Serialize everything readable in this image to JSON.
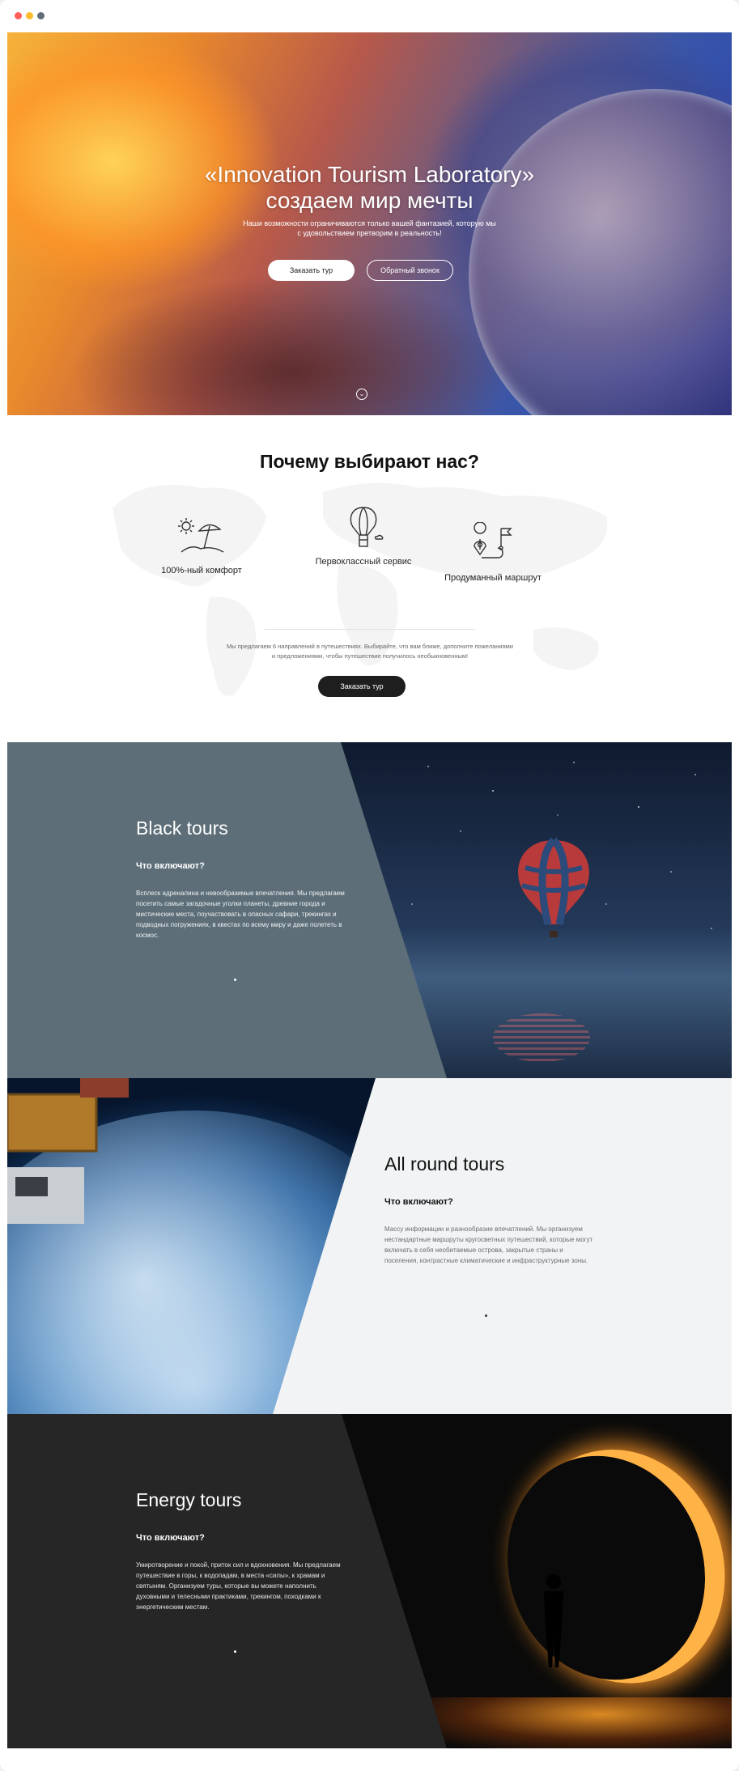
{
  "hero": {
    "title_line1": "«Innovation Tourism Laboratory»",
    "title_line2": "создаем мир мечты",
    "subtitle": "Наши возможности ограничиваются только вашей фантазией, которую мы с удовольствием претворим в реальность!",
    "order_button": "Заказать тур",
    "callback_button": "Обратный звонок",
    "scroll_icon": "chevron-down-icon"
  },
  "why": {
    "title": "Почему выбирают нас?",
    "features": [
      {
        "label": "100%-ный комфорт",
        "icon": "beach-umbrella-icon"
      },
      {
        "label": "Первоклассный сервис",
        "icon": "hot-air-balloon-icon"
      },
      {
        "label": "Продуманный маршрут",
        "icon": "route-map-icon"
      }
    ],
    "description": "Мы предлагаем 6 направлений в путешествиях. Выбирайте, что вам ближе, дополните пожеланиями и предложениями, чтобы путешествие получилось необыкновенным!",
    "button": "Заказать тур"
  },
  "tours": [
    {
      "title": "Black tours",
      "subtitle": "Что включают?",
      "description": "Всплеск адреналина и невообразимые впечатления. Мы предлагаем посетить самые загадочные уголки планеты, древние города и мистические места, поучаствовать в опасных сафари, трекингах и подводных погружениях, в квестах по всему миру и даже полететь в космос."
    },
    {
      "title": "All round tours",
      "subtitle": "Что включают?",
      "description": "Массу информации и разнообразие впечатлений. Мы организуем нестандартные маршруты кругосветных путешествий, которые могут включать в себя необитаемые острова, закрытые страны и поселения, контрастные климатические и инфраструктурные зоны."
    },
    {
      "title": "Energy tours",
      "subtitle": "Что включают?",
      "description": "Умиротворение и покой, приток сил и вдохновения. Мы предлагаем путешествие в горы, к водопадам, в места «силы», к храмам и святыням. Организуем туры, которые вы можете наполнить духовными и телесными практиками, трекингом, походками к энергетическим местам."
    }
  ],
  "colors": {
    "dark_button": "#1e1e1e",
    "black_tours_panel": "#5d6e78",
    "all_round_panel": "#f1f3f4",
    "energy_panel": "#262626"
  }
}
